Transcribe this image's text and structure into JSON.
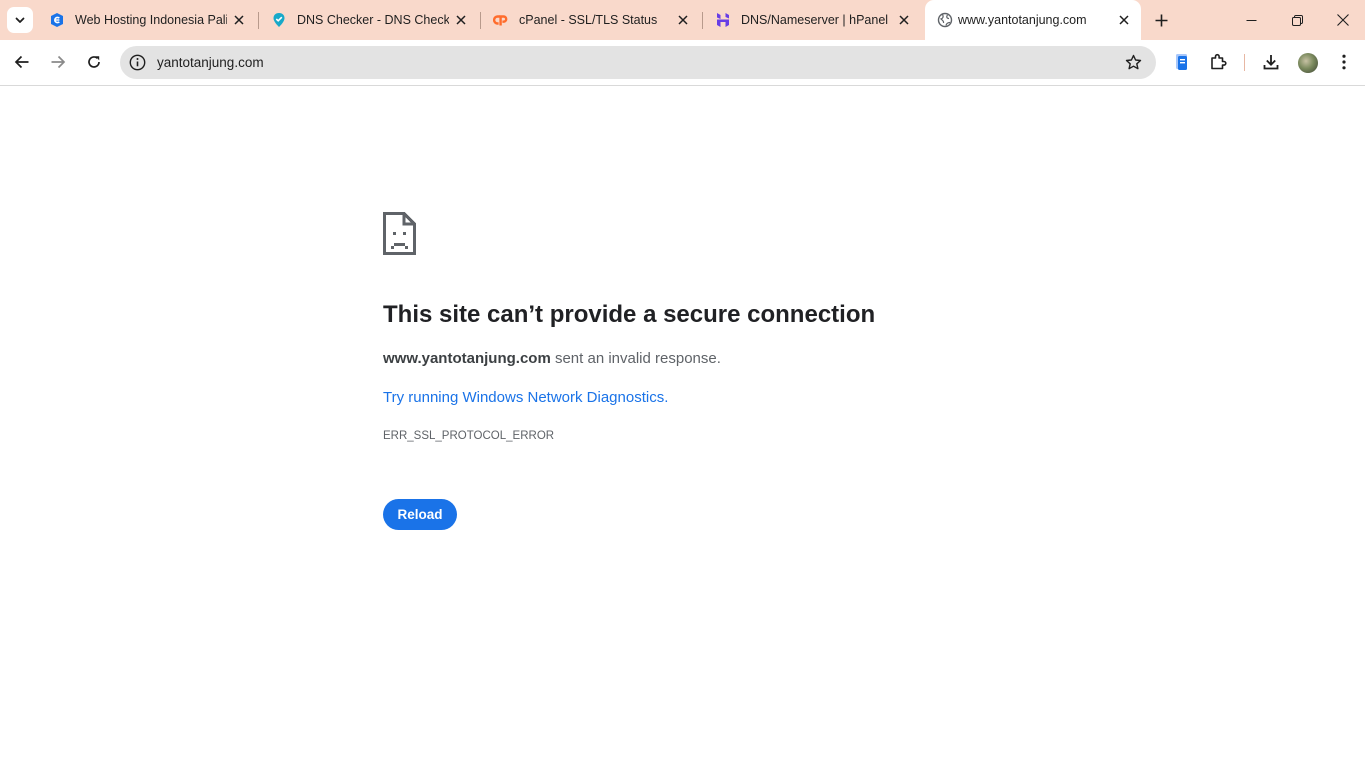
{
  "tabs": [
    {
      "title": "Web Hosting Indonesia Palin",
      "icon": "shield-e-icon",
      "color": "#1a73e8"
    },
    {
      "title": "DNS Checker - DNS Check P",
      "icon": "dns-checker-icon",
      "color": "#18a9c9"
    },
    {
      "title": "cPanel - SSL/TLS Status",
      "icon": "cpanel-icon",
      "color": "#ff6c2c"
    },
    {
      "title": "DNS/Nameserver | hPanel",
      "icon": "hostinger-icon",
      "color": "#673de6"
    },
    {
      "title": "www.yantotanjung.com",
      "icon": "globe-icon",
      "active": true
    }
  ],
  "omnibox": {
    "url": "yantotanjung.com"
  },
  "error": {
    "title": "This site can’t provide a secure connection",
    "host": "www.yantotanjung.com",
    "message": " sent an invalid response.",
    "link": "Try running Windows Network Diagnostics",
    "link_suffix": ".",
    "code": "ERR_SSL_PROTOCOL_ERROR",
    "reload_label": "Reload"
  },
  "colors": {
    "tabstrip": "#f9d9cb",
    "accent": "#1a73e8"
  }
}
